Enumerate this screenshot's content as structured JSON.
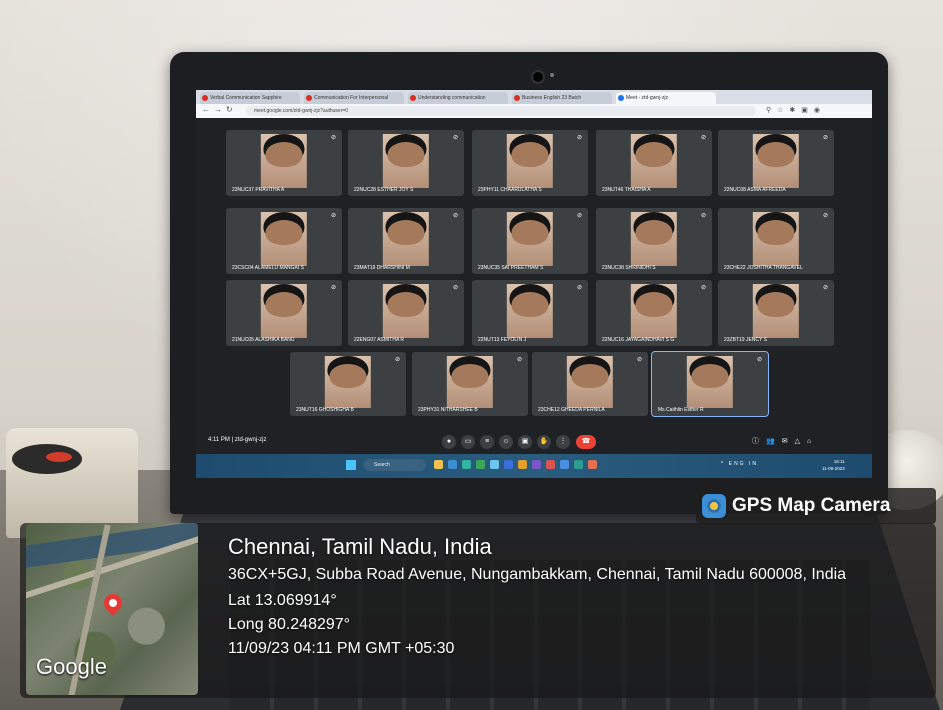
{
  "browser": {
    "tabs": [
      {
        "label": "Verbal Communication Sapphire",
        "active": false
      },
      {
        "label": "Communication For Interpersonal",
        "active": false
      },
      {
        "label": "Understanding communication",
        "active": false
      },
      {
        "label": "Business English 23 Batch",
        "active": false
      },
      {
        "label": "Meet - ztd-gwnj-zjz",
        "active": true
      }
    ],
    "url": "meet.google.com/ztd-gwnj-zjz?authuser=0"
  },
  "meet": {
    "participants": [
      "23NUC37 PRAVITHA A",
      "22NUC28 ESTHER JOY S",
      "23PHY11 CHAARULATHA S",
      "23NUT46 THAISHA A",
      "22NUC08 ASMA AFREEDA",
      "23CSC04 ALAMELU MANGAI S",
      "23MAT19 DHARSHINI M",
      "23NUC35 SAI PREETHAM S",
      "23NUC38 SHRINIDHI S",
      "23CHE22 JOSHITHA THANGAVEL",
      "21NUC05 ALASHIKA BANU",
      "22ENG07 ASMITHA R",
      "22NUT13 FEYOLIN J",
      "22NUC16 JAYAGAINDHAVI S G",
      "23ZBT19 JENCY S",
      "23NUT16 GHOSHIGHA B",
      "23PHY31 NITHARSHEE B",
      "23CHE12 GHEEDA PERNILA",
      "Ms.Caithlin Esther R"
    ],
    "time_code": "4:11 PM  |  ztd-gwnj-zjz"
  },
  "taskbar": {
    "search_label": "Search",
    "tray_text": "^ ENG IN",
    "clock_time": "16:11",
    "clock_date": "11-09-2023"
  },
  "gps": {
    "brand": "GPS Map Camera",
    "city": "Chennai, Tamil Nadu, India",
    "address": "36CX+5GJ, Subba Road Avenue, Nungambakkam, Chennai, Tamil Nadu 600008, India",
    "latitude": "Lat 13.069914°",
    "longitude": "Long 80.248297°",
    "timestamp": "11/09/23 04:11 PM GMT +05:30",
    "map_logo": "Google"
  },
  "colors": {
    "meet_end": "#ea4335",
    "taskbar": "#1e4b6e",
    "pin": "#e53935"
  }
}
